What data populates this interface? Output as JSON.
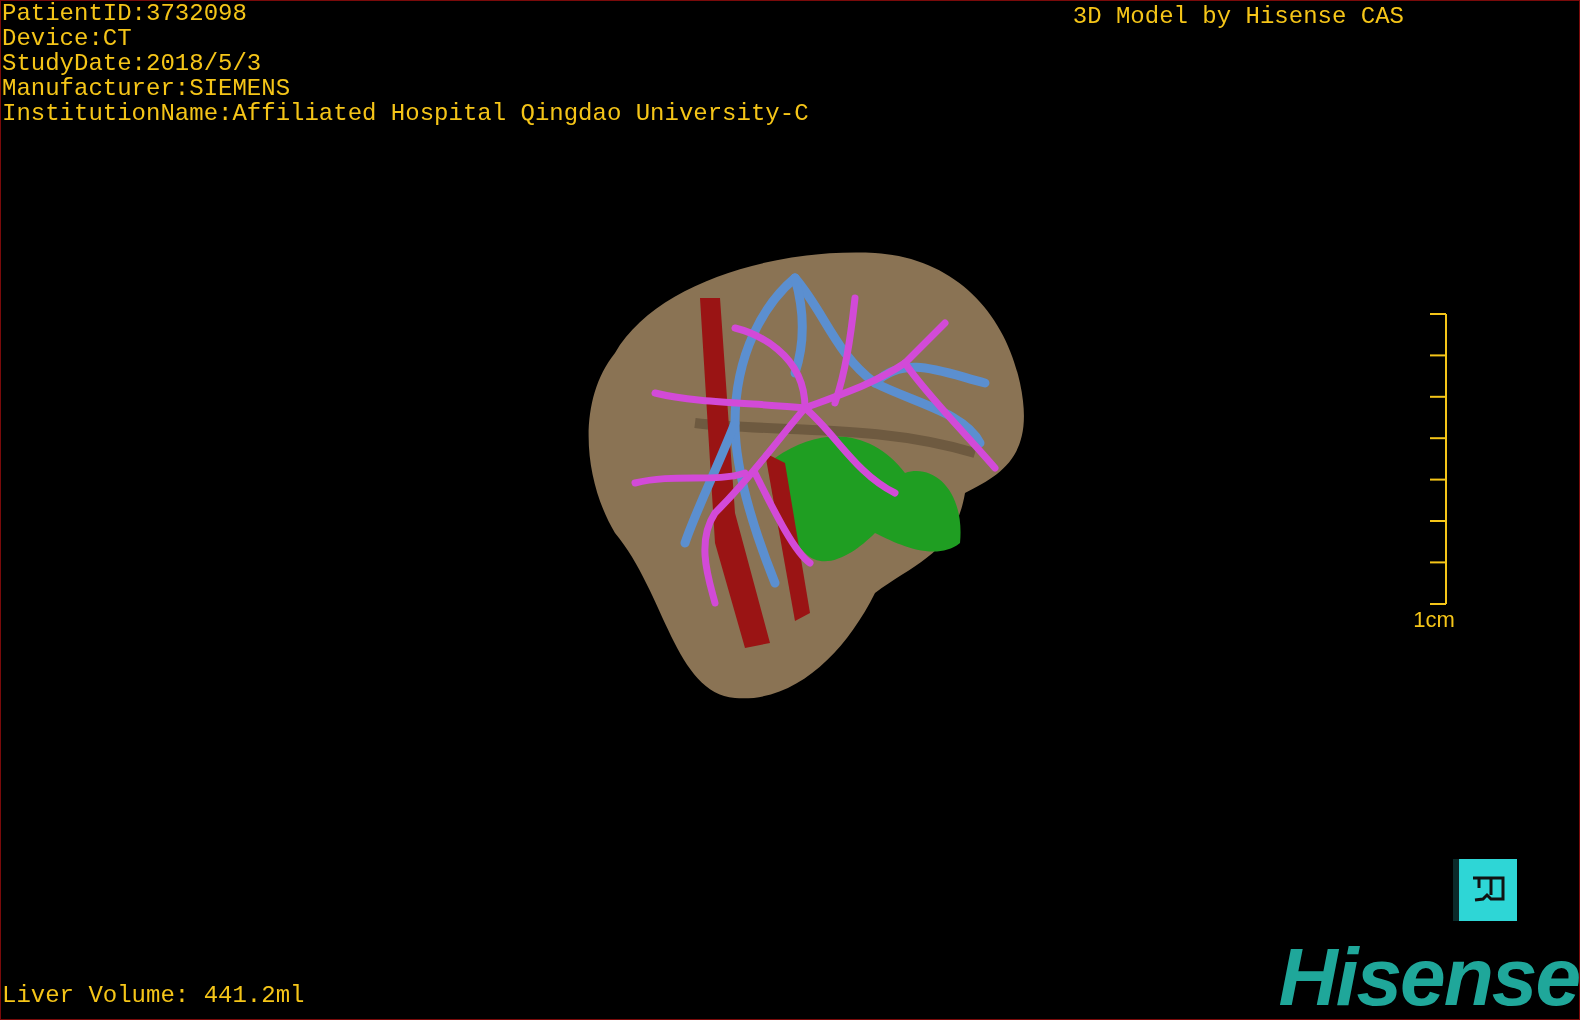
{
  "info_lines": [
    "PatientID:3732098",
    "Device:CT",
    "StudyDate:2018/5/3",
    "Manufacturer:SIEMENS",
    "InstitutionName:Affiliated Hospital Qingdao University-C"
  ],
  "credit": "3D Model by Hisense CAS",
  "scale": {
    "label": "1cm"
  },
  "liver_volume": "Liver Volume: 441.2ml",
  "logo": "Hisense"
}
